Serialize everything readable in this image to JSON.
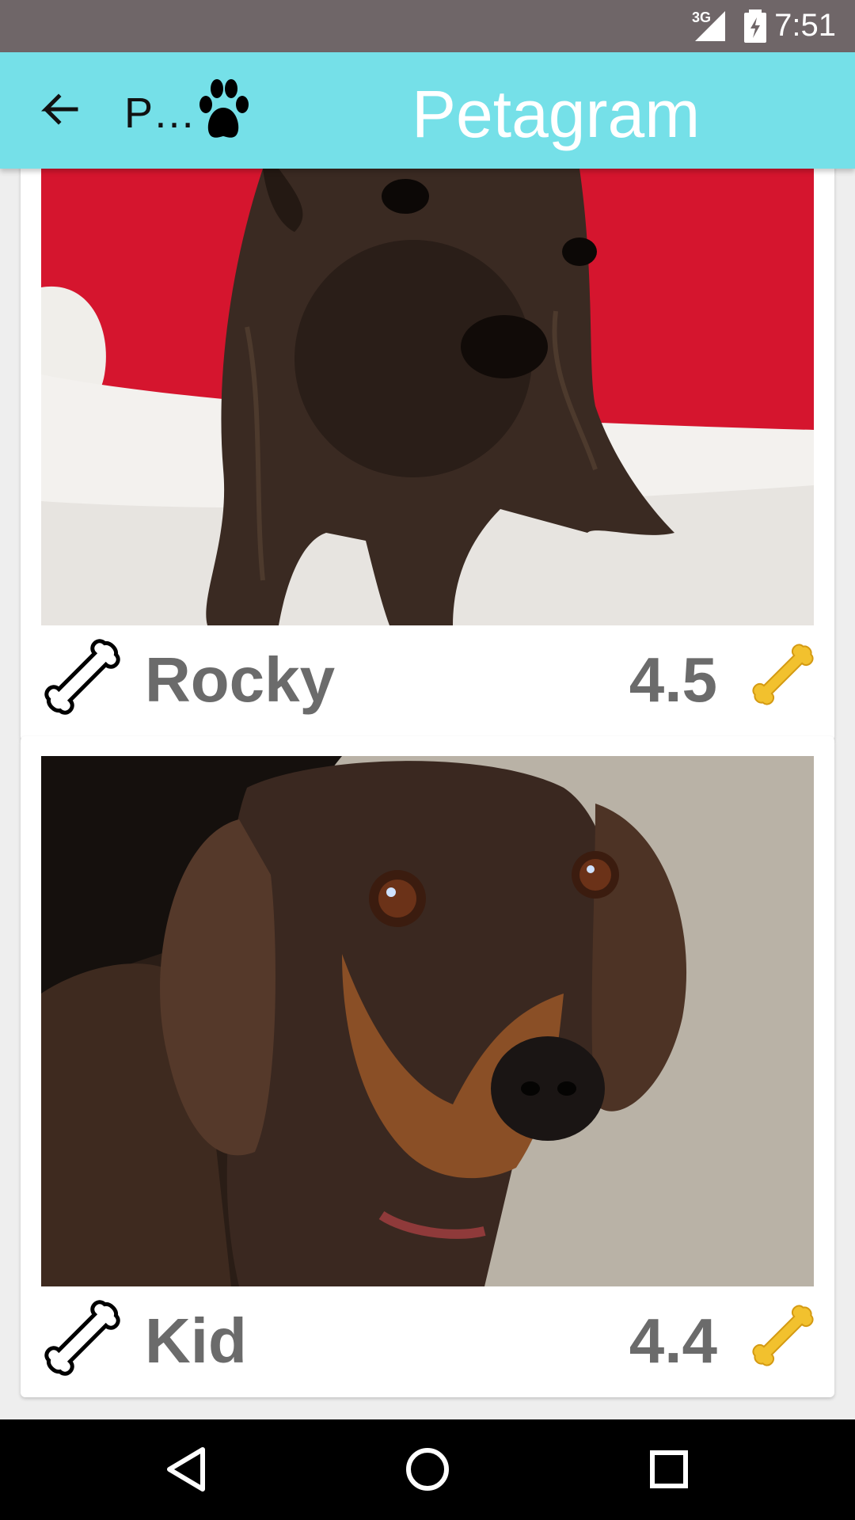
{
  "status_bar": {
    "network": "3G",
    "time": "7:51"
  },
  "app_bar": {
    "short_title": "P…",
    "title": "Petagram"
  },
  "pets": [
    {
      "name": "Rocky",
      "rating": "4.5"
    },
    {
      "name": "Kid",
      "rating": "4.4"
    }
  ],
  "colors": {
    "app_bar": "#75e0e8",
    "status_bar": "#6f6668",
    "text_gray": "#6b6b6b",
    "bone_gold": "#f2c12e"
  },
  "icons": {
    "back": "arrow-left-icon",
    "paw": "paw-icon",
    "like": "bone-outline-icon",
    "rating": "gold-bone-icon",
    "nav_back": "triangle-back-icon",
    "nav_home": "circle-home-icon",
    "nav_recent": "square-recent-icon"
  }
}
